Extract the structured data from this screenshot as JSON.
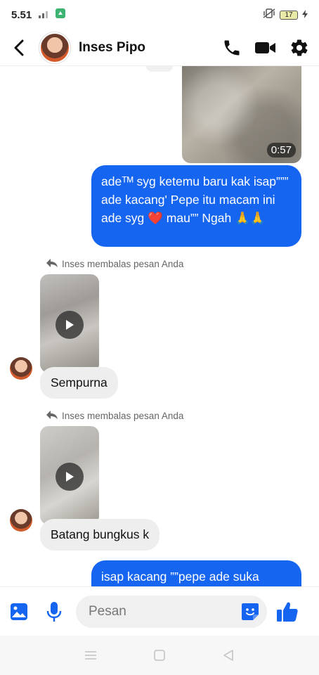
{
  "status_bar": {
    "time": "5.51",
    "signal_label": "ᵢᵢ|",
    "battery": "17"
  },
  "header": {
    "contact_name": "Inses Pipo"
  },
  "conversation": {
    "video_duration": "0:57",
    "own_message_1": "adeᵀᴹ syg ketemu baru kak isap””” ade kacang' Pepe itu macam ini ade syg ❤️ mau”” Ngah 🙏🙏",
    "reply_note_1": "Inses membalas pesan Anda",
    "their_message_1": "Sempurna",
    "reply_note_2": "Inses membalas pesan Anda",
    "their_message_2": "Batang bungkus k",
    "own_message_2": "isap kacang ””pepe ade suka"
  },
  "composer": {
    "placeholder": "Pesan"
  },
  "icons": {
    "back": "back-arrow-icon",
    "call": "phone-icon",
    "video": "video-camera-icon",
    "settings": "gear-icon",
    "gallery": "image-icon",
    "mic": "microphone-icon",
    "sticker": "sticker-icon",
    "like": "thumbs-up-icon"
  },
  "colors": {
    "accent": "#1565f0",
    "own_bubble": "#1565f0",
    "other_bubble": "#eeeeee"
  }
}
